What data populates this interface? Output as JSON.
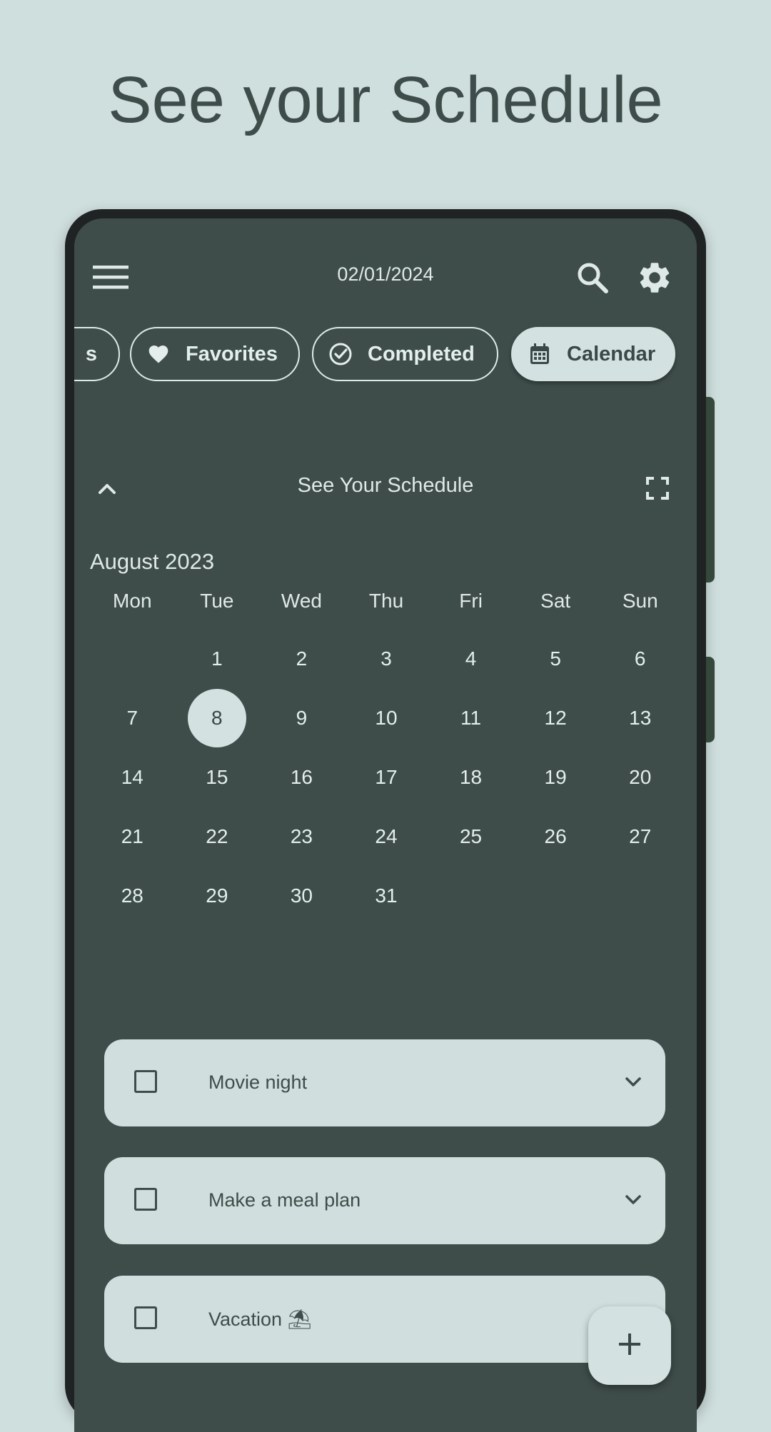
{
  "headline": "See your Schedule",
  "topbar": {
    "date": "02/01/2024",
    "menu_icon": "hamburger-menu-icon",
    "search_icon": "search-icon",
    "settings_icon": "gear-icon"
  },
  "chips": {
    "partial": "s",
    "favorites": "Favorites",
    "completed": "Completed",
    "calendar": "Calendar"
  },
  "schedule": {
    "title": "See Your Schedule",
    "collapse_icon": "chevron-up-icon",
    "fullscreen_icon": "fullscreen-icon"
  },
  "calendar": {
    "month": "August 2023",
    "weekdays": [
      "Mon",
      "Tue",
      "Wed",
      "Thu",
      "Fri",
      "Sat",
      "Sun"
    ],
    "selected_day": "8",
    "days": [
      "",
      "1",
      "2",
      "3",
      "4",
      "5",
      "6",
      "7",
      "8",
      "9",
      "10",
      "11",
      "12",
      "13",
      "14",
      "15",
      "16",
      "17",
      "18",
      "19",
      "20",
      "21",
      "22",
      "23",
      "24",
      "25",
      "26",
      "27",
      "28",
      "29",
      "30",
      "31",
      "",
      "",
      ""
    ]
  },
  "tasks": [
    {
      "label": "Movie night"
    },
    {
      "label": "Make a meal plan"
    },
    {
      "label": "Vacation ⛱"
    }
  ],
  "fab": {
    "icon": "plus-icon"
  },
  "colors": {
    "background": "#cfdfde",
    "screen": "#3e4d4a",
    "accent": "#d3e1e0"
  }
}
